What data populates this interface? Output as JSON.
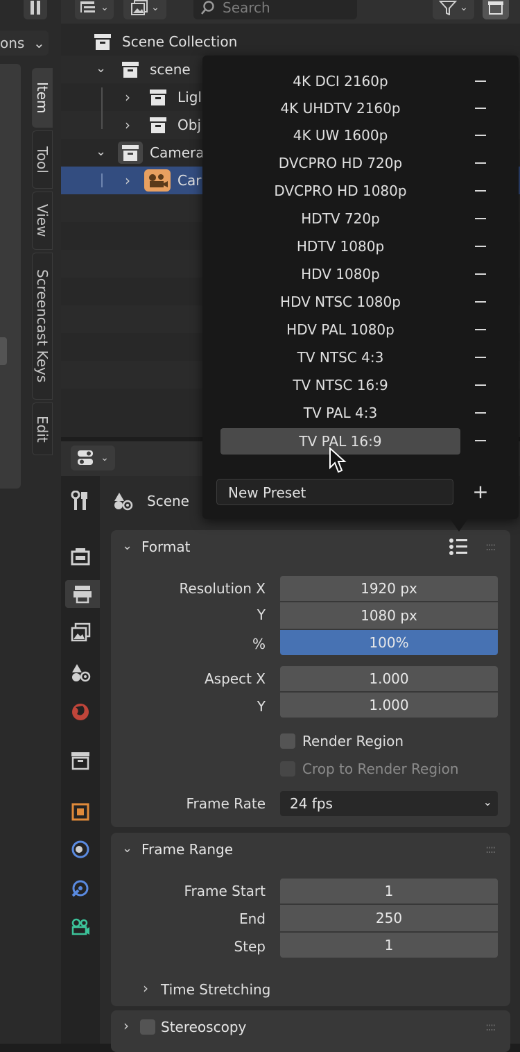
{
  "side_tabs": [
    "Item",
    "Tool",
    "View",
    "Screencast Keys",
    "Edit"
  ],
  "left_dropdown": "ons",
  "outliner": {
    "search_placeholder": "Search",
    "rows": [
      {
        "label": "Scene Collection"
      },
      {
        "label": "scene"
      },
      {
        "label": "Ligl"
      },
      {
        "label": "Obj"
      },
      {
        "label": "Camera"
      },
      {
        "label": "Car"
      }
    ]
  },
  "preset_menu": {
    "items": [
      "4K DCI 2160p",
      "4K UHDTV 2160p",
      "4K UW 1600p",
      "DVCPRO HD 720p",
      "DVCPRO HD 1080p",
      "HDTV 720p",
      "HDTV 1080p",
      "HDV 1080p",
      "HDV NTSC 1080p",
      "HDV PAL 1080p",
      "TV NTSC 4:3",
      "TV NTSC 16:9",
      "TV PAL 4:3",
      "TV PAL 16:9"
    ],
    "highlighted": "TV PAL 16:9",
    "new_preset_placeholder": "New Preset",
    "add_symbol": "+"
  },
  "properties": {
    "breadcrumb": "Scene",
    "format": {
      "title": "Format",
      "resolution_x_label": "Resolution X",
      "resolution_x": "1920 px",
      "y_label": "Y",
      "resolution_y": "1080 px",
      "percent_label": "%",
      "percent": "100%",
      "aspect_x_label": "Aspect X",
      "aspect_x": "1.000",
      "aspect_y_label": "Y",
      "aspect_y": "1.000",
      "render_region": "Render Region",
      "crop_region": "Crop to Render Region",
      "frame_rate_label": "Frame Rate",
      "frame_rate": "24 fps"
    },
    "frame_range": {
      "title": "Frame Range",
      "start_label": "Frame Start",
      "start": "1",
      "end_label": "End",
      "end": "250",
      "step_label": "Step",
      "step": "1",
      "time_stretching": "Time Stretching"
    },
    "stereoscopy": "Stereoscopy"
  },
  "colors": {
    "selection": "#334d80",
    "slider_blue": "#4772b3",
    "camera_orange": "#e8a060"
  }
}
